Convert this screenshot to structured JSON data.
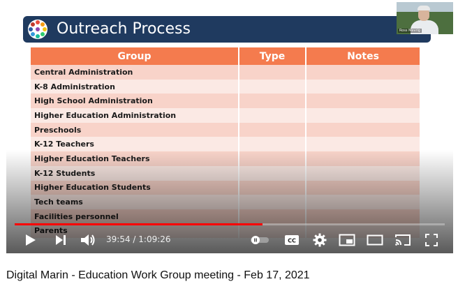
{
  "slide": {
    "title": "Outreach Process",
    "table": {
      "headers": [
        "Group",
        "Type",
        "Notes"
      ],
      "rows": [
        {
          "group": "Central Administration",
          "type": "",
          "notes": ""
        },
        {
          "group": "K-8 Administration",
          "type": "",
          "notes": ""
        },
        {
          "group": "High School Administration",
          "type": "",
          "notes": ""
        },
        {
          "group": "Higher Education Administration",
          "type": "",
          "notes": ""
        },
        {
          "group": "Preschools",
          "type": "",
          "notes": ""
        },
        {
          "group": "K-12 Teachers",
          "type": "",
          "notes": ""
        },
        {
          "group": "Higher Education Teachers",
          "type": "",
          "notes": ""
        },
        {
          "group": "K-12 Students",
          "type": "",
          "notes": ""
        },
        {
          "group": "Higher Education Students",
          "type": "",
          "notes": ""
        },
        {
          "group": "Tech teams",
          "type": "",
          "notes": ""
        },
        {
          "group": "Facilities personnel",
          "type": "",
          "notes": ""
        },
        {
          "group": "Parents",
          "type": "",
          "notes": ""
        }
      ]
    }
  },
  "webcam": {
    "name_label": "Ross Mevrig"
  },
  "player": {
    "current_time": "39:54",
    "separator": " / ",
    "duration": "1:09:26",
    "progress_fraction": 0.577,
    "controls": {
      "play": "play-icon",
      "next": "next-icon",
      "volume": "volume-icon",
      "autoplay": "autoplay-toggle-icon",
      "captions": "CC",
      "settings": "gear-icon",
      "miniplayer": "miniplayer-icon",
      "theater": "theater-icon",
      "cast": "cast-icon",
      "fullscreen": "fullscreen-icon"
    },
    "accent_color": "#ff0000"
  },
  "video_title": "Digital Marin - Education Work Group meeting - Feb 17, 2021"
}
